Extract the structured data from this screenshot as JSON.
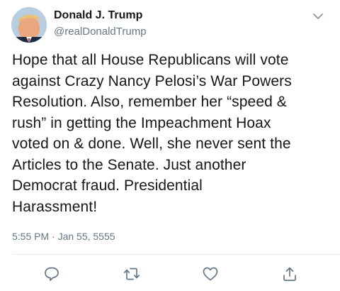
{
  "author": {
    "display_name": "Donald J. Trump",
    "handle": "@realDonaldTrump",
    "avatar_icon": "profile-photo"
  },
  "tweet": {
    "lines": [
      "Hope that all House Republicans will vote",
      "against Crazy Nancy Pelosi’s War Powers",
      "Resolution. Also, remember her “speed &",
      "rush” in getting the Impeachment Hoax",
      "voted on & done. Well, she never sent the",
      "Articles to the Senate. Just another",
      "Democrat fraud. Presidential",
      "Harassment!"
    ],
    "timestamp": "5:55 PM · Jan 55, 5555"
  },
  "actions": {
    "icons": [
      "reply-icon",
      "retweet-icon",
      "like-icon",
      "share-icon"
    ],
    "color": "#657786"
  },
  "colors": {
    "text": "#14171a",
    "secondary": "#657786",
    "divider": "#e6ecf0"
  }
}
